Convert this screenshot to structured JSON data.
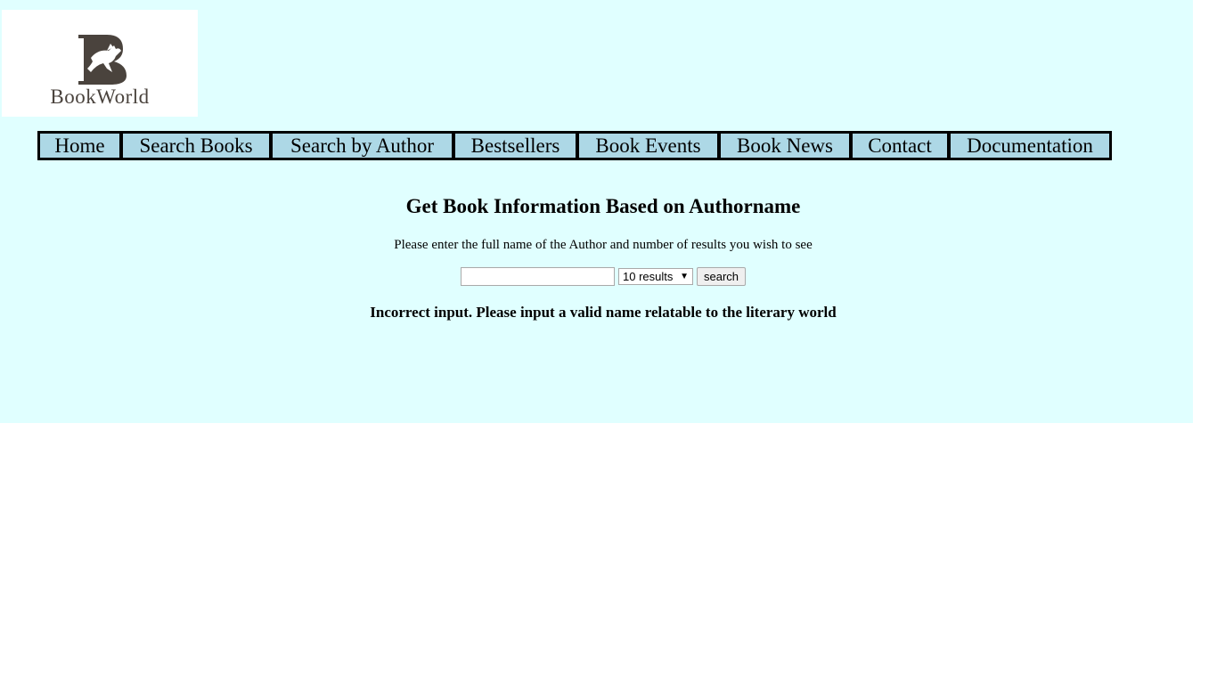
{
  "logo": {
    "text": "BookWorld",
    "icon": "horse-b-logo-icon"
  },
  "nav": {
    "items": [
      {
        "label": "Home"
      },
      {
        "label": "Search Books"
      },
      {
        "label": "Search by Author"
      },
      {
        "label": "Bestsellers"
      },
      {
        "label": "Book Events"
      },
      {
        "label": "Book News"
      },
      {
        "label": "Contact"
      },
      {
        "label": "Documentation"
      }
    ]
  },
  "main": {
    "title": "Get Book Information Based on Authorname",
    "instructions": "Please enter the full name of the Author and number of results you wish to see",
    "author_input": {
      "value": "",
      "placeholder": ""
    },
    "results_select": {
      "selected": "10 results"
    },
    "search_button_label": "search",
    "error_message": "Incorrect input. Please input a valid name relatable to the literary world"
  },
  "colors": {
    "page_background": "#e0ffff",
    "nav_item_background": "#add8e6",
    "nav_border": "#000000",
    "logo_color": "#4a433d"
  }
}
